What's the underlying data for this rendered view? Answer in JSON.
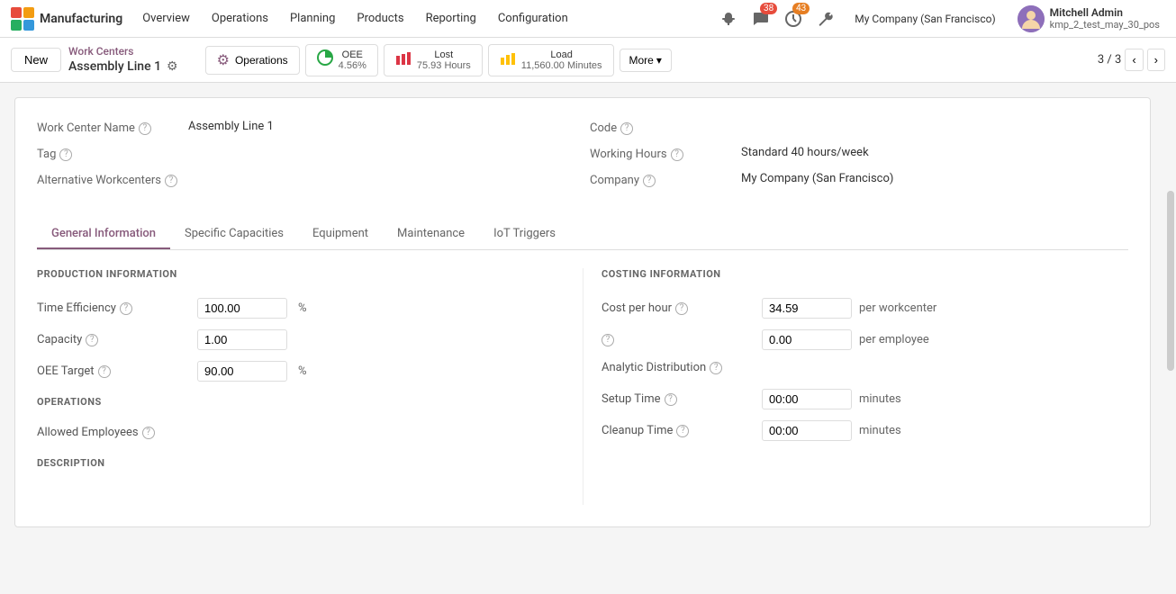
{
  "app": {
    "name": "Manufacturing",
    "logo_color": "#e74c3c"
  },
  "nav": {
    "items": [
      "Overview",
      "Operations",
      "Planning",
      "Products",
      "Reporting",
      "Configuration"
    ],
    "badge_messages": "38",
    "badge_clock": "43",
    "user_name": "Mitchell Admin",
    "user_company": "kmp_2_test_may_30_pos"
  },
  "toolbar": {
    "new_label": "New",
    "breadcrumb_parent": "Work Centers",
    "breadcrumb_current": "Assembly Line 1",
    "operations_label": "Operations",
    "oee_label": "OEE",
    "oee_value": "4.56%",
    "lost_label": "Lost",
    "lost_value": "75.93 Hours",
    "load_label": "Load",
    "load_value": "11,560.00 Minutes",
    "more_label": "More",
    "pager": "3 / 3"
  },
  "form": {
    "work_center_name_label": "Work Center Name",
    "work_center_name_value": "Assembly Line 1",
    "tag_label": "Tag",
    "tag_value": "",
    "alternative_label": "Alternative Workcenters",
    "code_label": "Code",
    "code_value": "",
    "working_hours_label": "Working Hours",
    "working_hours_value": "Standard 40 hours/week",
    "company_label": "Company",
    "company_value": "My Company (San Francisco)"
  },
  "tabs": [
    {
      "id": "general",
      "label": "General Information",
      "active": true
    },
    {
      "id": "specific",
      "label": "Specific Capacities",
      "active": false
    },
    {
      "id": "equipment",
      "label": "Equipment",
      "active": false
    },
    {
      "id": "maintenance",
      "label": "Maintenance",
      "active": false
    },
    {
      "id": "iot",
      "label": "IoT Triggers",
      "active": false
    }
  ],
  "general_tab": {
    "production_section_title": "PRODUCTION INFORMATION",
    "time_efficiency_label": "Time Efficiency",
    "time_efficiency_value": "100.00",
    "time_efficiency_unit": "%",
    "capacity_label": "Capacity",
    "capacity_value": "1.00",
    "oee_target_label": "OEE Target",
    "oee_target_value": "90.00",
    "oee_target_unit": "%",
    "operations_section_title": "OPERATIONS",
    "allowed_employees_label": "Allowed Employees",
    "description_section_title": "DESCRIPTION",
    "costing_section_title": "COSTING INFORMATION",
    "cost_per_hour_label": "Cost per hour",
    "cost_per_hour_value": "34.59",
    "cost_per_hour_unit": "per workcenter",
    "extra_cost_label": "",
    "extra_cost_value": "0.00",
    "extra_cost_unit": "per employee",
    "analytic_distribution_label": "Analytic Distribution",
    "setup_time_label": "Setup Time",
    "setup_time_value": "00:00",
    "setup_time_unit": "minutes",
    "cleanup_time_label": "Cleanup Time",
    "cleanup_time_value": "00:00",
    "cleanup_time_unit": "minutes"
  }
}
